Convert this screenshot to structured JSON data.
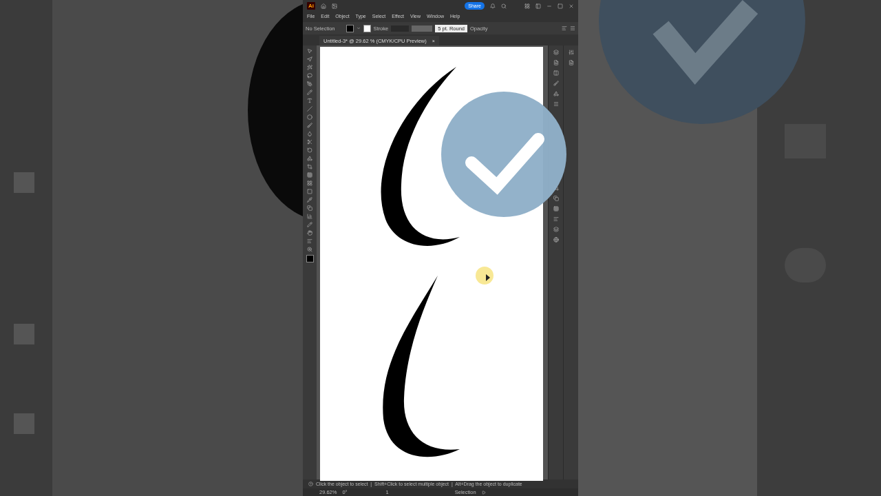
{
  "title_bar": {
    "logo": "Ai",
    "share": "Share"
  },
  "menu": [
    "File",
    "Edit",
    "Object",
    "Type",
    "Select",
    "Effect",
    "View",
    "Window",
    "Help"
  ],
  "control_bar": {
    "selection": "No Selection",
    "stroke_label": "Stroke",
    "brush": "5 pt. Round",
    "opacity": "Opacity"
  },
  "document_tab": {
    "title": "Untitled-3* @ 29.62 % (CMYK/CPU Preview)",
    "close": "×"
  },
  "hint_bar": {
    "text": "Click the object to select  |  Shift+Click to select multiple object  |  Alt+Drag the object to duplicate"
  },
  "status_bar": {
    "zoom": "29.62%",
    "rotation": "0°",
    "artboard": "1",
    "tool": "Selection"
  }
}
